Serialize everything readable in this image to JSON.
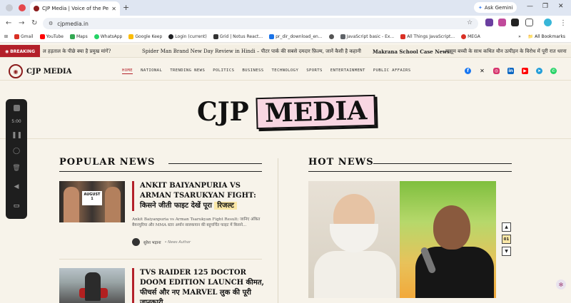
{
  "browser": {
    "tab_title": "CJP Media | Voice of the People",
    "url": "cjpmedia.in",
    "ask_gemini": "Ask Gemini",
    "bookmarks": [
      "Gmail",
      "YouTube",
      "Maps",
      "WhatsApp",
      "Google Keep",
      "Login (current)",
      "Grid | Notus React...",
      "pr_dir_download_en...",
      "JavaScript basic - Ex...",
      "All Things JavaScript...",
      "MEGA"
    ],
    "all_bookmarks": "All Bookmarks",
    "bookmark_colors": [
      "#d93025",
      "#ff0000",
      "#34a853",
      "#25d366",
      "#fbbc04",
      "#202124",
      "#333333",
      "#1a73e8",
      "#555555",
      "#5f6368",
      "#d93025"
    ]
  },
  "ticker": {
    "label": "BREAKING",
    "items": [
      "ल हड़ताल के पीछे क्या है प्रमुख मांगें?",
      "Spider Man Brand New Day Review in Hindi – पीटर पार्क की सबसे दमदार फ़िल्म, जानें कैसी है कहानी",
      "Makrana School Case News:",
      "मासूम बच्ची के साथ कथित यौन उत्पीड़न के विरोध में पूरी रात धरना"
    ]
  },
  "site": {
    "logo_text": "CJP MEDIA",
    "nav": [
      "HOME",
      "NATIONAL",
      "TRENDING NEWS",
      "POLITICS",
      "BUSINESS",
      "TECHNOLOGY",
      "SPORTS",
      "ENTERTAINMENT",
      "PUBLIC AFFAIRS"
    ],
    "masthead_left": "CJP",
    "masthead_right": "MEDIA"
  },
  "recorder": {
    "time": "5:00"
  },
  "popular_news": {
    "title": "POPULAR NEWS",
    "article1": {
      "title_main": "ANKIT BAIYANPURIA VS ARMAN TSARUKYAN FIGHT: किसने जीती फाइट देखें पूरा",
      "title_highlight": "रिजल्ट",
      "thumb_text": "AUGUST 1",
      "excerpt": "Ankit Baiyanpuria vs Arman Tsarukyan Fight Result: जानिए अंकित बैयनपुरिया और MMA स्टार अर्मान सारुकयान की बहुचर्चित फाइट में किसने...",
      "author": "सुरेश भड़ाना",
      "role": "• News Author"
    },
    "article2": {
      "title_main": "TVS RAIDER 125 DOCTOR DOOM EDITION LAUNCH कीमत, फीचर्स और नए MARVEL लुक की पूरी जानकारी"
    }
  },
  "hot_news": {
    "title": "HOT NEWS",
    "pager_up": "▲",
    "pager_current": "01",
    "pager_down": "▼"
  }
}
